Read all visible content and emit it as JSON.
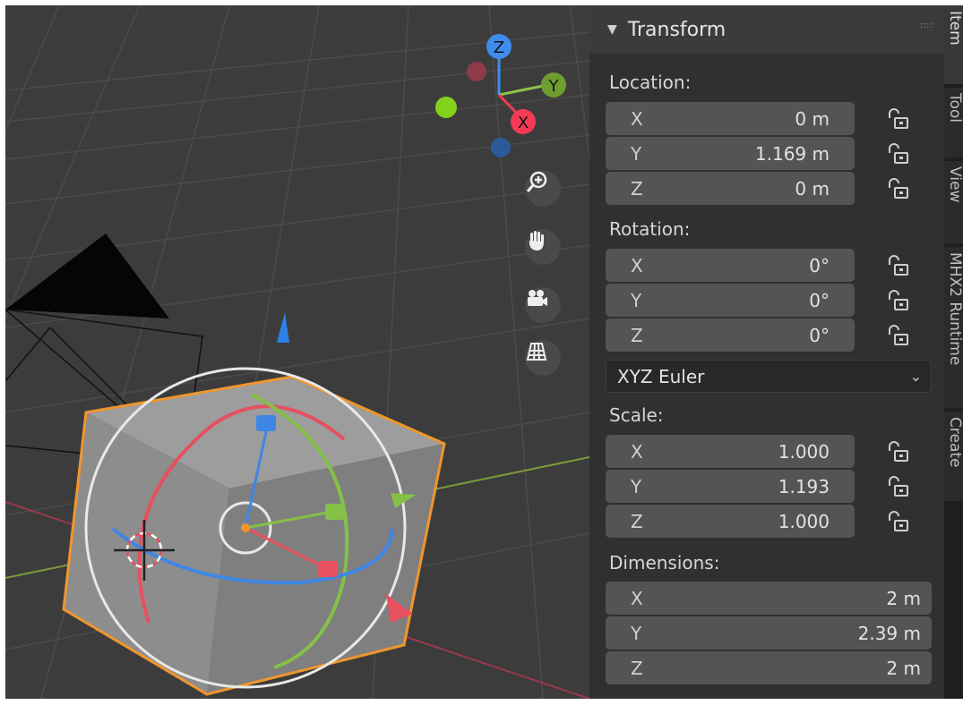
{
  "panel": {
    "title": "Transform",
    "location": {
      "label": "Location:",
      "x": {
        "axis": "X",
        "value": "0 m"
      },
      "y": {
        "axis": "Y",
        "value": "1.169 m"
      },
      "z": {
        "axis": "Z",
        "value": "0 m"
      }
    },
    "rotation": {
      "label": "Rotation:",
      "x": {
        "axis": "X",
        "value": "0°"
      },
      "y": {
        "axis": "Y",
        "value": "0°"
      },
      "z": {
        "axis": "Z",
        "value": "0°"
      },
      "mode": "XYZ Euler"
    },
    "scale": {
      "label": "Scale:",
      "x": {
        "axis": "X",
        "value": "1.000"
      },
      "y": {
        "axis": "Y",
        "value": "1.193"
      },
      "z": {
        "axis": "Z",
        "value": "1.000"
      }
    },
    "dimensions": {
      "label": "Dimensions:",
      "x": {
        "axis": "X",
        "value": "2 m"
      },
      "y": {
        "axis": "Y",
        "value": "2.39 m"
      },
      "z": {
        "axis": "Z",
        "value": "2 m"
      }
    }
  },
  "tabs": [
    "Item",
    "Tool",
    "View",
    "MHX2 Runtime",
    "Create"
  ],
  "gizmo": {
    "z": "Z",
    "y": "Y",
    "x": "X"
  },
  "viewport_tools": [
    "zoom-icon",
    "hand-pan-icon",
    "camera-icon",
    "grid-icon"
  ],
  "colors": {
    "x_axis": "#f53a55",
    "y_axis": "#8bc24a",
    "z_axis": "#3f8ced",
    "selection": "#f0962d"
  }
}
